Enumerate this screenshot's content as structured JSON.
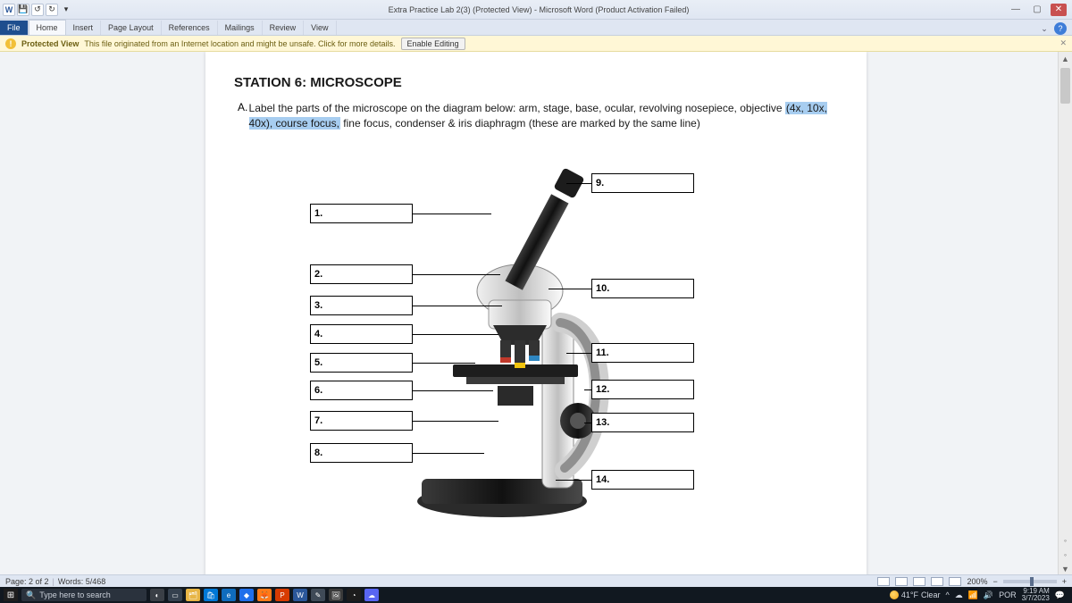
{
  "titlebar": {
    "doc_title": "Extra Practice Lab 2(3) (Protected View) - Microsoft Word (Product Activation Failed)",
    "min": "—",
    "max": "▢",
    "close": "✕",
    "qat_word": "W",
    "qat_save": "💾",
    "qat_undo": "↺",
    "qat_redo": "↻",
    "qat_more": "▾"
  },
  "ribbon": {
    "file": "File",
    "home": "Home",
    "insert": "Insert",
    "pagelayout": "Page Layout",
    "references": "References",
    "mailings": "Mailings",
    "review": "Review",
    "view": "View",
    "helpminimize": "⌄",
    "helpq": "?"
  },
  "protected": {
    "label": "Protected View",
    "msg": "This file originated from an Internet location and might be unsafe. Click for more details.",
    "enable": "Enable Editing",
    "close": "✕"
  },
  "doc": {
    "station": "STATION 6: MICROSCOPE",
    "letter": "A.",
    "instr1": "Label the parts of the microscope on the diagram below: arm, stage, base, ocular, revolving nosepiece, objective ",
    "instr_hl": "(4x, 10x, 40x), course focus,",
    "instr2": " fine focus, condenser & iris diaphragm (these are marked by the same line)",
    "labels": {
      "l1": "1.",
      "l2": "2.",
      "l3": "3.",
      "l4": "4.",
      "l5": "5.",
      "l6": "6.",
      "l7": "7.",
      "l8": "8.",
      "r9": "9.",
      "r10": "10.",
      "r11": "11.",
      "r12": "12.",
      "r13": "13.",
      "r14": "14."
    }
  },
  "statusbar": {
    "page": "Page: 2 of 2",
    "words": "Words: 5/468",
    "zoom": "200%",
    "minus": "−",
    "plus": "+"
  },
  "taskbar": {
    "search_placeholder": "Type here to search",
    "weather_temp": "41°F",
    "weather_text": "Clear",
    "time": "9:19 AM",
    "date": "3/7/2023",
    "lang": "POR",
    "caret": "^"
  }
}
